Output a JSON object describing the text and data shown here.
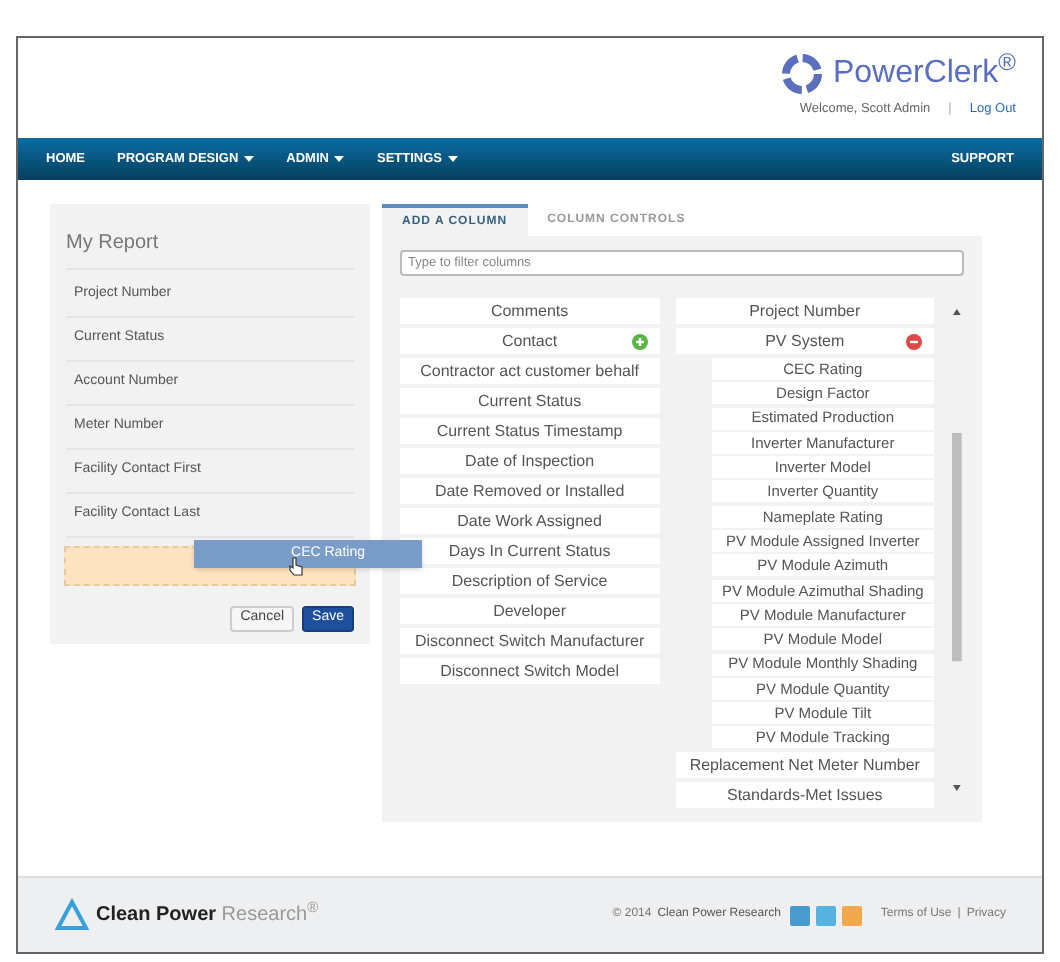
{
  "header": {
    "logo": "PowerClerk$^{®}$",
    "welcome": "Welcome, Scott Admin",
    "separator": "|",
    "logout": "Log Out"
  },
  "nav": {
    "items": [
      {
        "label": "HOME",
        "dropdown": false
      },
      {
        "label": "PROGRAM DESIGN",
        "dropdown": true
      },
      {
        "label": "ADMIN",
        "dropdown": true
      },
      {
        "label": "SETTINGS",
        "dropdown": true
      }
    ],
    "right": "SUPPORT"
  },
  "report": {
    "title": "My Report",
    "fields": [
      "Project Number",
      "Current Status",
      "Account Number",
      "Meter Number",
      "Facility Contact First",
      "Facility Contact Last"
    ],
    "dragged_item": "CEC Rating",
    "buttons": [
      {
        "label": "Cancel",
        "kind": "secondary"
      },
      {
        "label": "Save",
        "kind": "primary"
      }
    ]
  },
  "tabs": [
    {
      "label": "ADD A COLUMN",
      "selected": true
    },
    {
      "label": "COLUMN CONTROLS",
      "selected": false
    }
  ],
  "filter": {
    "placeholder": "Type to filter columns"
  },
  "columns_left": [
    {
      "label": "Comments",
      "kind": "field"
    },
    {
      "label": "Contact",
      "kind": "group",
      "expanded": false
    },
    {
      "label": "Contractor act customer behalf",
      "kind": "field"
    },
    {
      "label": "Current Status",
      "kind": "field"
    },
    {
      "label": "Current Status Timestamp",
      "kind": "field"
    },
    {
      "label": "Date of Inspection",
      "kind": "field"
    },
    {
      "label": "Date Removed or Installed",
      "kind": "field"
    },
    {
      "label": "Date Work Assigned",
      "kind": "field"
    },
    {
      "label": "Days In Current Status",
      "kind": "field"
    },
    {
      "label": "Description of Service",
      "kind": "field"
    },
    {
      "label": "Developer",
      "kind": "field"
    },
    {
      "label": "Disconnect Switch Manufacturer",
      "kind": "field"
    },
    {
      "label": "Disconnect Switch Model",
      "kind": "field"
    }
  ],
  "columns_right": [
    {
      "label": "Project Number",
      "kind": "field"
    },
    {
      "label": "PV System",
      "kind": "group",
      "expanded": true,
      "children": [
        "CEC Rating",
        "Design Factor",
        "Estimated Production",
        "Inverter Manufacturer",
        "Inverter Model",
        "Inverter Quantity",
        "Nameplate Rating",
        "PV Module Assigned Inverter",
        "PV Module Azimuth",
        "PV Module Azimuthal Shading",
        "PV Module Manufacturer",
        "PV Module Model",
        "PV Module Monthly Shading",
        "PV Module Quantity",
        "PV Module Tilt",
        "PV Module Tracking"
      ]
    },
    {
      "label": "Replacement Net Meter Number",
      "kind": "field"
    },
    {
      "label": "Standards-Met Issues",
      "kind": "field"
    }
  ],
  "footer": {
    "brand": "**Clean Power** Research$^{®}$",
    "copyright": "© 2014",
    "company": "Clean Power Research",
    "terms": "Terms of Use",
    "separator": "|",
    "privacy": "Privacy"
  }
}
